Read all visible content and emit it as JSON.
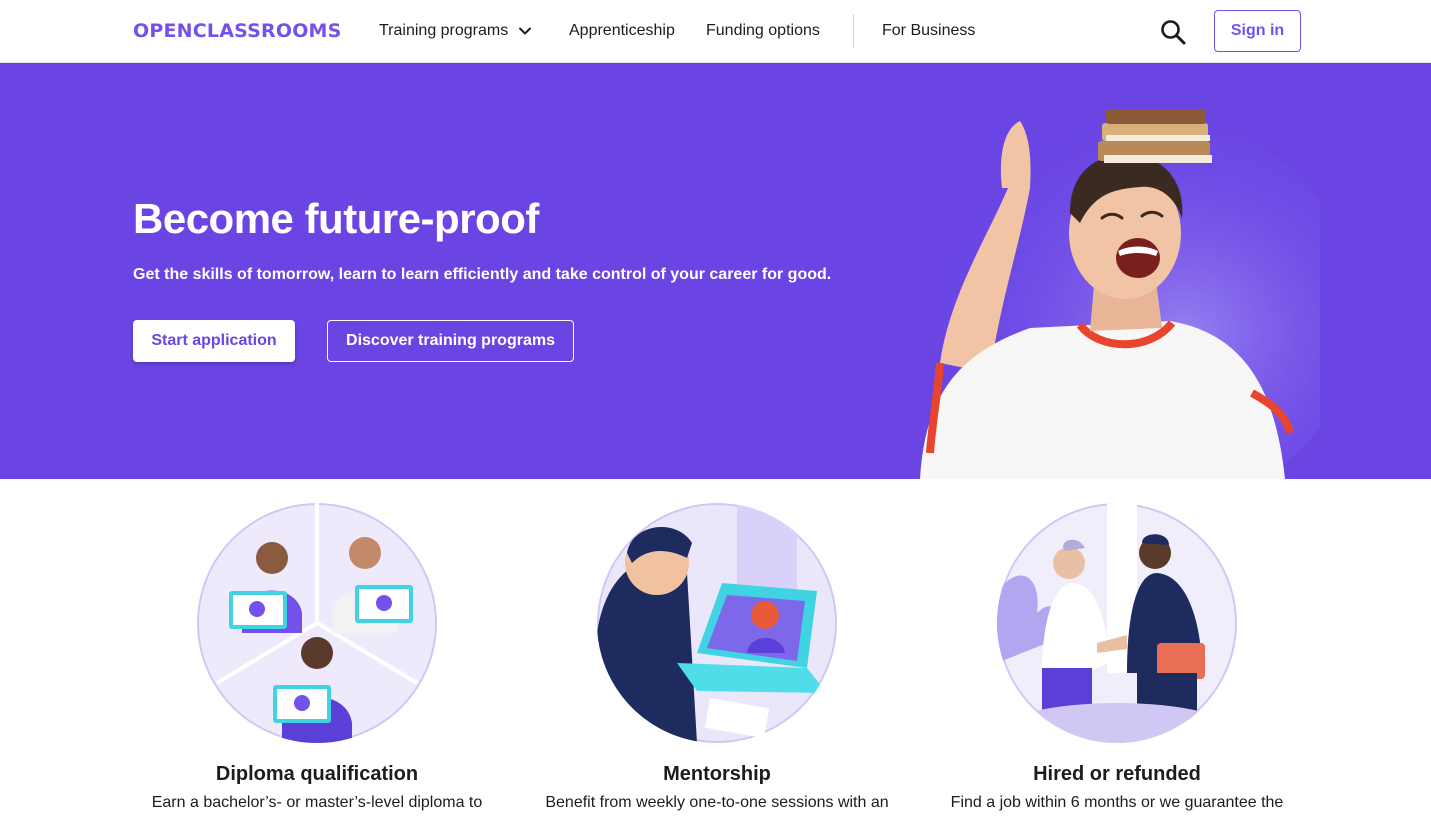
{
  "brand": {
    "logo_text": "OPENCLASSROOMS",
    "accent": "#7451eb",
    "hero_bg": "#6a45e4"
  },
  "nav": {
    "training": "Training programs",
    "apprenticeship": "Apprenticeship",
    "funding": "Funding options",
    "business": "For Business",
    "search_icon": "search-icon",
    "signin": "Sign in"
  },
  "hero": {
    "title": "Become future-proof",
    "subtitle": "Get the skills of tomorrow, learn to learn efficiently and take control of your career for good.",
    "primary_button": "Start application",
    "secondary_button": "Discover training programs"
  },
  "features": [
    {
      "title": "Diploma qualification",
      "description": "Earn a bachelor’s- or master’s-level diploma to"
    },
    {
      "title": "Mentorship",
      "description": "Benefit from weekly one-to-one sessions with an"
    },
    {
      "title": "Hired or refunded",
      "description": "Find a job within 6 months or we guarantee the"
    }
  ]
}
